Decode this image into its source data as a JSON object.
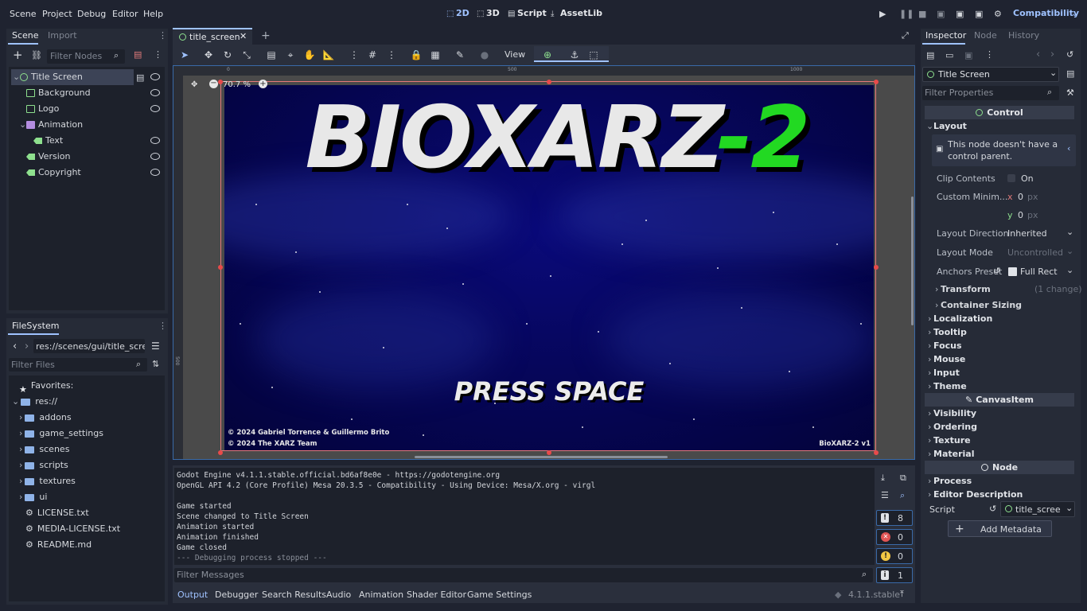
{
  "menubar": {
    "items": [
      "Scene",
      "Project",
      "Debug",
      "Editor",
      "Help"
    ],
    "workspaces": [
      "2D",
      "3D",
      "Script",
      "AssetLib"
    ],
    "renderer": "Compatibility"
  },
  "scene_dock": {
    "tabs": [
      "Scene",
      "Import"
    ],
    "filter_placeholder": "Filter Nodes",
    "nodes": [
      {
        "label": "Title Screen",
        "icon": "control-icon",
        "depth": 0,
        "eye": true
      },
      {
        "label": "Background",
        "icon": "texture-rect-icon",
        "depth": 1,
        "eye": true
      },
      {
        "label": "Logo",
        "icon": "texture-rect-icon",
        "depth": 1,
        "eye": true
      },
      {
        "label": "Animation",
        "icon": "animation-player-icon",
        "depth": 1,
        "eye": false
      },
      {
        "label": "Text",
        "icon": "label-icon",
        "depth": 2,
        "eye": true
      },
      {
        "label": "Version",
        "icon": "label-icon",
        "depth": 1,
        "eye": true
      },
      {
        "label": "Copyright",
        "icon": "label-icon",
        "depth": 1,
        "eye": true
      }
    ]
  },
  "filesystem": {
    "title": "FileSystem",
    "path": "res://scenes/gui/title_screen.",
    "filter_placeholder": "Filter Files",
    "favorites": "Favorites:",
    "root": "res://",
    "folders": [
      "addons",
      "game_settings",
      "scenes",
      "scripts",
      "textures",
      "ui"
    ],
    "files": [
      "LICENSE.txt",
      "MEDIA-LICENSE.txt",
      "README.md"
    ]
  },
  "editor": {
    "tab": "title_screen",
    "view_label": "View",
    "zoom": "70.7 %",
    "ruler": [
      "0",
      "500",
      "1000"
    ],
    "ruler_left": "500"
  },
  "game_view": {
    "title_main": "BIOXARZ",
    "title_accent": "-2",
    "press": "PRESS SPACE",
    "copyright1": "© 2024 Gabriel Torrence & Guillermo Brito",
    "copyright2": "© 2024 The XARZ Team",
    "version": "BioXARZ-2 v1"
  },
  "output": {
    "lines": [
      "Godot Engine v4.1.1.stable.official.bd6af8e0e - https://godotengine.org",
      "OpenGL API 4.2 (Core Profile) Mesa 20.3.5 - Compatibility - Using Device: Mesa/X.org - virgl",
      "",
      "Game started",
      "Scene changed to Title Screen",
      "Animation started",
      "Animation finished",
      "Game closed",
      "--- Debugging process stopped ---"
    ],
    "filter_placeholder": "Filter Messages",
    "counts": {
      "messages": "8",
      "errors": "0",
      "warnings": "0",
      "info": "1"
    },
    "bottom_tabs": [
      "Output",
      "Debugger",
      "Search Results",
      "Audio",
      "Animation",
      "Shader Editor",
      "Game Settings"
    ],
    "version": "4.1.1.stable"
  },
  "inspector": {
    "tabs": [
      "Inspector",
      "Node",
      "History"
    ],
    "node": "Title Screen",
    "filter_placeholder": "Filter Properties",
    "section_control": "Control",
    "layout": "Layout",
    "warning": "This node doesn't have a control parent.",
    "clip_contents": "Clip Contents",
    "clip_value": "On",
    "custom_min": "Custom Minim...",
    "x_label": "x",
    "x_value": "0",
    "y_label": "y",
    "y_value": "0",
    "px": "px",
    "layout_direction": "Layout Direction",
    "layout_direction_value": "Inherited",
    "layout_mode": "Layout Mode",
    "layout_mode_value": "Uncontrolled",
    "anchors_preset": "Anchors Preset",
    "anchors_value": "Full Rect",
    "transform": "Transform",
    "transform_note": "(1 change)",
    "container_sizing": "Container Sizing",
    "groups1": [
      "Localization",
      "Tooltip",
      "Focus",
      "Mouse",
      "Input",
      "Theme"
    ],
    "section_canvas": "CanvasItem",
    "groups2": [
      "Visibility",
      "Ordering",
      "Texture",
      "Material"
    ],
    "section_node": "Node",
    "groups3": [
      "Process",
      "Editor Description"
    ],
    "script_label": "Script",
    "script_value": "title_scree",
    "add_metadata": "Add Metadata"
  },
  "colors": {
    "accent": "#9fc2ff",
    "title_green": "#22d922",
    "sky": "#0a0a6e"
  }
}
